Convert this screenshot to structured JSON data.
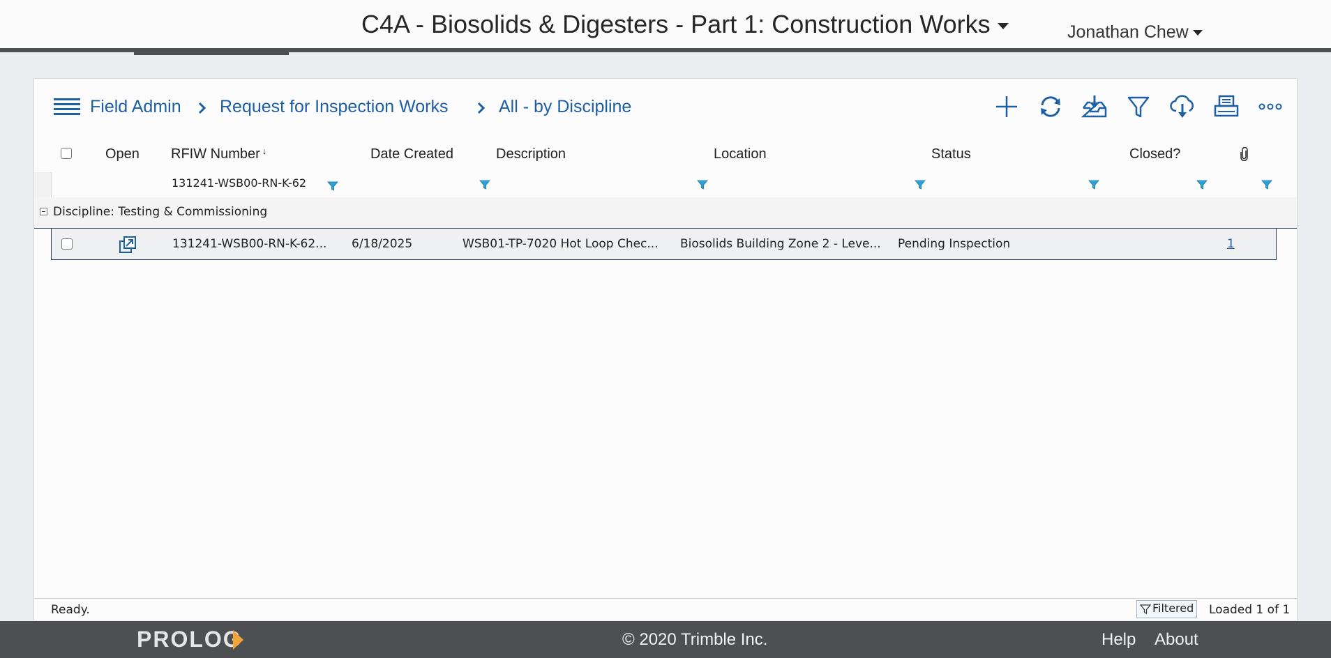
{
  "header": {
    "project_title": "C4A - Biosolids & Digesters - Part 1: Construction Works",
    "user_name": "Jonathan Chew"
  },
  "breadcrumb": {
    "items": [
      "Field Admin",
      "Request for Inspection Works",
      "All - by Discipline"
    ]
  },
  "toolbar": {
    "icons": [
      "add-icon",
      "refresh-icon",
      "import-icon",
      "filter-icon",
      "cloud-download-icon",
      "print-icon",
      "more-icon"
    ]
  },
  "table": {
    "columns": [
      "Open",
      "RFIW Number",
      "Date Created",
      "Description",
      "Location",
      "Status",
      "Closed?"
    ],
    "sort_indicator": "↓",
    "filter_value": "131241-WSB00-RN-K-62",
    "group_label": "Discipline: Testing & Commissioning",
    "rows": [
      {
        "rfiw_number": "131241-WSB00-RN-K-62...",
        "date_created": "6/18/2025",
        "description": "WSB01-TP-7020 Hot Loop Chec...",
        "location": "Biosolids Building Zone 2 - Leve...",
        "status": "Pending Inspection",
        "closed": "",
        "attachments": "1"
      }
    ]
  },
  "status_bar": {
    "status": "Ready.",
    "filtered_label": "Filtered",
    "loaded": "Loaded 1 of 1"
  },
  "footer": {
    "logo": "PROLOG",
    "copyright": "© 2020 Trimble Inc.",
    "links": [
      "Help",
      "About"
    ]
  },
  "colors": {
    "link_blue": "#1d5fa5",
    "funnel_blue": "#2aa3d8",
    "footer_bg": "#4d4f53",
    "logo_accent": "#f0a43a"
  }
}
